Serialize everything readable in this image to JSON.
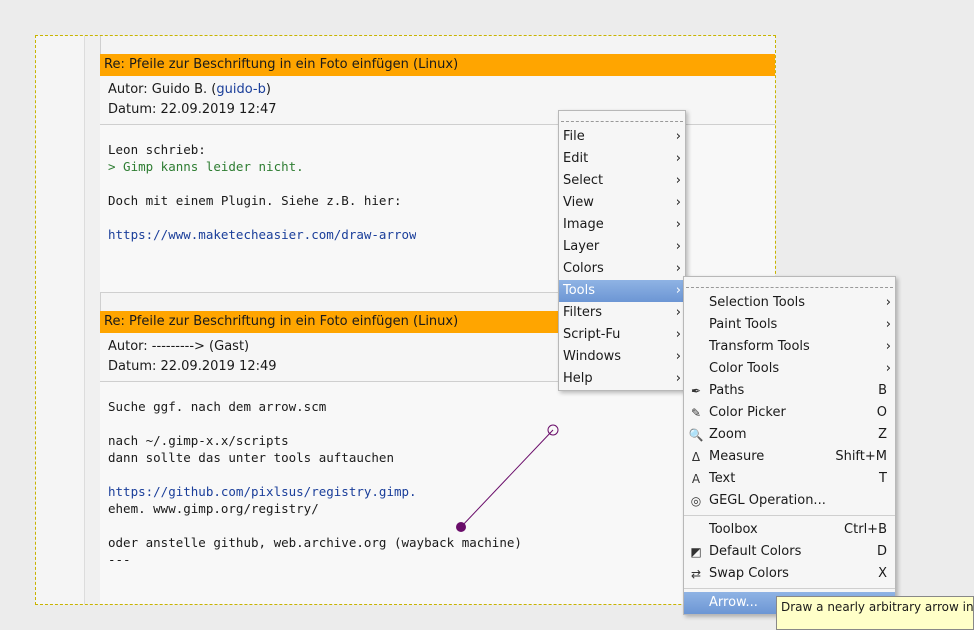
{
  "posts": [
    {
      "title": "Re: Pfeile zur Beschriftung in ein Foto einfügen (Linux)",
      "author_label": "Autor: Guido B. (",
      "author_link": "guido-b",
      "author_suffix": ")",
      "date": "Datum: 22.09.2019 12:47",
      "lines": [
        {
          "text": "Leon schrieb:",
          "kind": "normal"
        },
        {
          "text": "> Gimp kanns leider nicht.",
          "kind": "quote"
        },
        {
          "text": "",
          "kind": "normal"
        },
        {
          "text": "Doch mit einem Plugin. Siehe z.B. hier:",
          "kind": "normal"
        },
        {
          "text": "",
          "kind": "normal"
        },
        {
          "text": "https://www.maketecheasier.com/draw-arrows-in-gimp/",
          "kind": "link"
        }
      ]
    },
    {
      "title": "Re: Pfeile zur Beschriftung in ein Foto einfügen (Linux)",
      "author_label": "Autor: ---------> (Gast)",
      "date": "Datum: 22.09.2019 12:49",
      "lines": [
        {
          "text": "Suche ggf. nach dem arrow.scm",
          "kind": "normal"
        },
        {
          "text": "",
          "kind": "normal"
        },
        {
          "text": "nach ~/.gimp-x.x/scripts",
          "kind": "normal"
        },
        {
          "text": "dann sollte das unter tools auftauchen",
          "kind": "normal"
        },
        {
          "text": "",
          "kind": "normal"
        },
        {
          "text": "https://github.com/pixlsus/registry.gimp.org",
          "kind": "link"
        },
        {
          "text": "ehem. www.gimp.org/registry/",
          "kind": "normal"
        },
        {
          "text": "",
          "kind": "normal"
        },
        {
          "text": "oder anstelle github, web.archive.org (wayback machine)",
          "kind": "normal"
        },
        {
          "text": "---",
          "kind": "normal"
        }
      ]
    }
  ],
  "main_menu": [
    {
      "label": "File",
      "submenu": true
    },
    {
      "label": "Edit",
      "submenu": true
    },
    {
      "label": "Select",
      "submenu": true
    },
    {
      "label": "View",
      "submenu": true
    },
    {
      "label": "Image",
      "submenu": true
    },
    {
      "label": "Layer",
      "submenu": true
    },
    {
      "label": "Colors",
      "submenu": true
    },
    {
      "label": "Tools",
      "submenu": true,
      "highlighted": true
    },
    {
      "label": "Filters",
      "submenu": true
    },
    {
      "label": "Script-Fu",
      "submenu": true
    },
    {
      "label": "Windows",
      "submenu": true
    },
    {
      "label": "Help",
      "submenu": true
    }
  ],
  "tools_menu": [
    {
      "label": "Selection Tools",
      "submenu": true
    },
    {
      "label": "Paint Tools",
      "submenu": true
    },
    {
      "label": "Transform Tools",
      "submenu": true
    },
    {
      "label": "Color Tools",
      "submenu": true
    },
    {
      "label": "Paths",
      "accel": "B",
      "icon": "paths-icon",
      "glyph": "✒"
    },
    {
      "label": "Color Picker",
      "accel": "O",
      "icon": "color-picker-icon",
      "glyph": "✎"
    },
    {
      "label": "Zoom",
      "accel": "Z",
      "icon": "zoom-icon",
      "glyph": "🔍"
    },
    {
      "label": "Measure",
      "accel": "Shift+M",
      "icon": "measure-icon",
      "glyph": "Δ"
    },
    {
      "label": "Text",
      "accel": "T",
      "icon": "text-icon",
      "glyph": "A"
    },
    {
      "label": "GEGL Operation...",
      "icon": "gegl-icon",
      "glyph": "◎"
    },
    {
      "separator": true
    },
    {
      "label": "Toolbox",
      "accel": "Ctrl+B"
    },
    {
      "label": "Default Colors",
      "accel": "D",
      "icon": "default-colors-icon",
      "glyph": "◩"
    },
    {
      "label": "Swap Colors",
      "accel": "X",
      "icon": "swap-colors-icon",
      "glyph": "⇄"
    },
    {
      "separator": true
    },
    {
      "label": "Arrow...",
      "highlighted": true
    }
  ],
  "tooltip": "Draw a nearly arbitrary arrow in your image",
  "colors": {
    "title_bar": "#ffa500",
    "highlight": "#6c96d4",
    "path": "#6a0d6a",
    "tooltip_bg": "#ffffc8"
  }
}
